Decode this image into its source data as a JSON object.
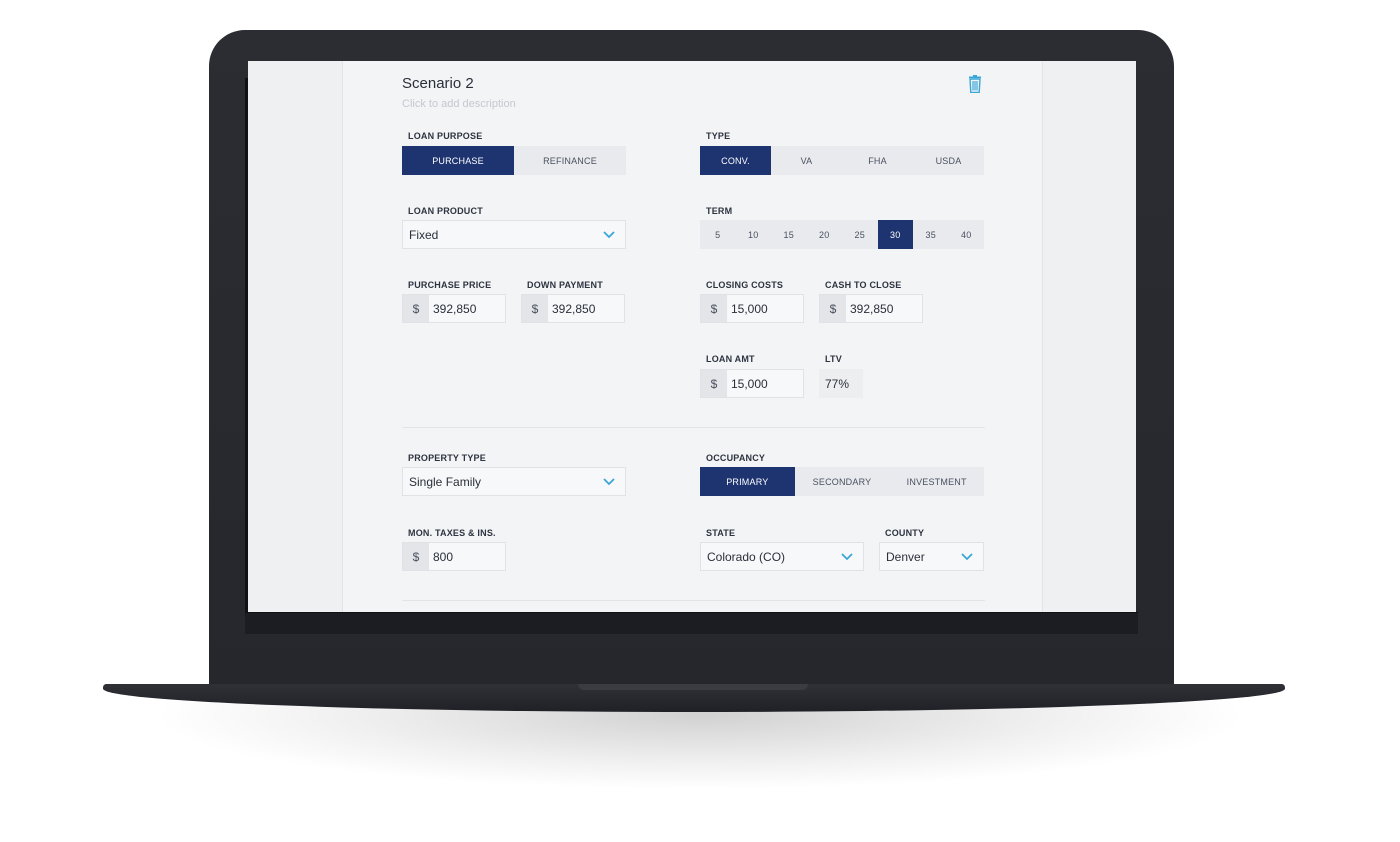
{
  "scenario": {
    "title": "Scenario 2",
    "description_placeholder": "Click to add description"
  },
  "icons": {
    "delete": "trash-icon",
    "dropdown": "chevron-down-icon"
  },
  "colors": {
    "accent": "#1e3470",
    "icon_blue": "#3aa6d8"
  },
  "loan_purpose": {
    "label": "LOAN PURPOSE",
    "options": [
      "PURCHASE",
      "REFINANCE"
    ],
    "selected": "PURCHASE"
  },
  "type": {
    "label": "TYPE",
    "options": [
      "CONV.",
      "VA",
      "FHA",
      "USDA"
    ],
    "selected": "CONV."
  },
  "loan_product": {
    "label": "LOAN PRODUCT",
    "value": "Fixed"
  },
  "term": {
    "label": "TERM",
    "options": [
      "5",
      "10",
      "15",
      "20",
      "25",
      "30",
      "35",
      "40"
    ],
    "selected": "30"
  },
  "purchase_price": {
    "label": "PURCHASE PRICE",
    "currency": "$",
    "value": "392,850"
  },
  "down_payment": {
    "label": "DOWN PAYMENT",
    "currency": "$",
    "value": "392,850"
  },
  "closing_costs": {
    "label": "CLOSING COSTS",
    "currency": "$",
    "value": "15,000"
  },
  "cash_to_close": {
    "label": "CASH TO CLOSE",
    "currency": "$",
    "value": "392,850"
  },
  "loan_amt": {
    "label": "LOAN AMT",
    "currency": "$",
    "value": "15,000"
  },
  "ltv": {
    "label": "LTV",
    "value": "77%"
  },
  "property_type": {
    "label": "PROPERTY TYPE",
    "value": "Single Family"
  },
  "occupancy": {
    "label": "OCCUPANCY",
    "options": [
      "PRIMARY",
      "SECONDARY",
      "INVESTMENT"
    ],
    "selected": "PRIMARY"
  },
  "mon_taxes": {
    "label": "MON. TAXES & INS.",
    "currency": "$",
    "value": "800"
  },
  "state": {
    "label": "STATE",
    "value": "Colorado (CO)"
  },
  "county": {
    "label": "COUNTY",
    "value": "Denver"
  }
}
